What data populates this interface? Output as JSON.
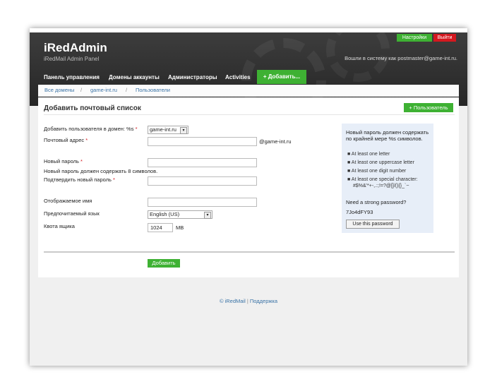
{
  "header": {
    "logo": "iRedAdmin",
    "logo_sub": "iRedMail Admin Panel",
    "settings_label": "Настройки",
    "logout_label": "Выйти",
    "logged_in_text": "Вошли в систему как postmaster@game-int.ru."
  },
  "nav": {
    "items": [
      "Панель управления",
      "Домены аккаунты",
      "Администраторы",
      "Activities"
    ],
    "add_label": "+ Добавить..."
  },
  "breadcrumb": {
    "items": [
      "Все домены",
      "game-int.ru",
      "Пользователи"
    ],
    "separator": "/"
  },
  "form": {
    "title": "Добавить почтовый список",
    "users_button": "+ Пользователь",
    "domain_label": "Добавить пользователя в домен: %s",
    "domain_value": "game-int.ru",
    "email_label": "Почтовый адрес",
    "email_domain_suffix": "@game-int.ru",
    "password_label": "Новый пароль",
    "password_hint": "Новый пароль должен содержать 8 символов.",
    "confirm_label": "Подтвердить новый пароль",
    "display_name_label": "Отображаемое имя",
    "language_label": "Предпочитаемый язык",
    "language_value": "English (US)",
    "quota_label": "Квота ящика",
    "quota_value": "1024",
    "quota_unit": "MB",
    "submit_label": "Добавить",
    "required_mark": "*"
  },
  "sidebar": {
    "heading": "Новый пароль должен содержать по крайней мере %s символов.",
    "rules": [
      "At least one letter",
      "At least one uppercase letter",
      "At least one digit number",
      "At least one special character:",
      "#$%&'*+-,.:;!=?@[]/(){}_`~"
    ],
    "strong_heading": "Need a strong password?",
    "generated_password": "7Jo4dFY93",
    "use_button": "Use this password"
  },
  "footer": {
    "copyright": "© iRedMail",
    "separator": "|",
    "support": "Поддержка"
  }
}
